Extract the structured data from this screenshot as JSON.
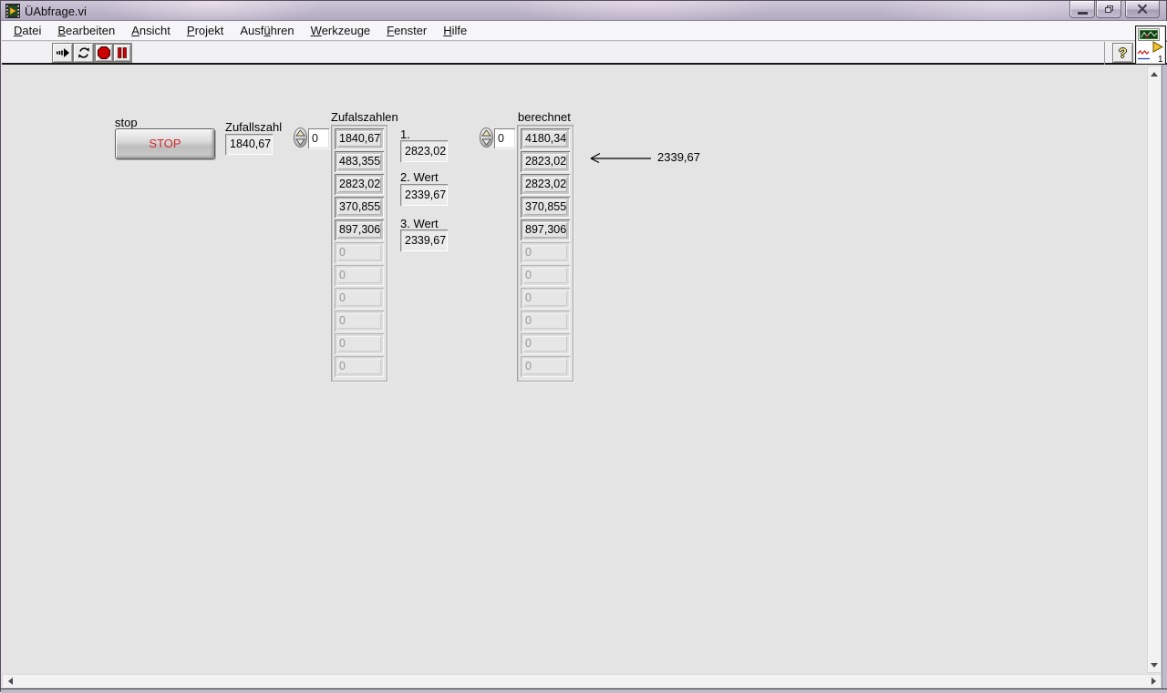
{
  "window": {
    "title": "ÜAbfrage.vi"
  },
  "menu": {
    "items": [
      {
        "pre": "",
        "accel": "D",
        "post": "atei"
      },
      {
        "pre": "",
        "accel": "B",
        "post": "earbeiten"
      },
      {
        "pre": "",
        "accel": "A",
        "post": "nsicht"
      },
      {
        "pre": "",
        "accel": "P",
        "post": "rojekt"
      },
      {
        "pre": "Ausf",
        "accel": "ü",
        "post": "hren"
      },
      {
        "pre": "",
        "accel": "W",
        "post": "erkzeuge"
      },
      {
        "pre": "",
        "accel": "F",
        "post": "enster"
      },
      {
        "pre": "",
        "accel": "H",
        "post": "ilfe"
      }
    ]
  },
  "toolbar": {
    "help_label": "?",
    "vi_icon_number": "1"
  },
  "icons": {
    "titlebar": [
      "labview-app-icon",
      "minimize-icon",
      "restore-icon",
      "close-icon"
    ],
    "toolbar": [
      "run-icon",
      "continuous-run-icon",
      "abort-icon",
      "pause-icon",
      "help-icon",
      "vi-icon"
    ],
    "scrollbars": [
      "scroll-up-icon",
      "scroll-down-icon",
      "scroll-left-icon",
      "scroll-right-icon"
    ]
  },
  "colors": {
    "panel_bg": "#e4e4e4",
    "titlebar": "#bdb5c9",
    "stop_button_text": "#cf2b2b",
    "abort_icon_red": "#cc0000",
    "disabled_text": "#979797"
  },
  "panel": {
    "stop": {
      "label": "stop",
      "button": "STOP"
    },
    "zufallszahl": {
      "label": "Zufallszahl",
      "value": "1840,67"
    },
    "zufalszahlen": {
      "label": "Zufalszahlen",
      "index": "0",
      "values": [
        "1840,67",
        "483,355",
        "2823,02",
        "370,855",
        "897,306",
        "0",
        "0",
        "0",
        "0",
        "0",
        "0"
      ]
    },
    "wert1": {
      "label": "1.",
      "value": "2823,02"
    },
    "wert2": {
      "label": "2. Wert",
      "value": "2339,67"
    },
    "wert3": {
      "label": "3. Wert",
      "value": "2339,67"
    },
    "berechnet": {
      "label": "berechnet",
      "index": "0",
      "values": [
        "4180,34",
        "2823,02",
        "2823,02",
        "370,855",
        "897,306",
        "0",
        "0",
        "0",
        "0",
        "0",
        "0"
      ]
    },
    "annotation": {
      "value": "2339,67"
    }
  }
}
